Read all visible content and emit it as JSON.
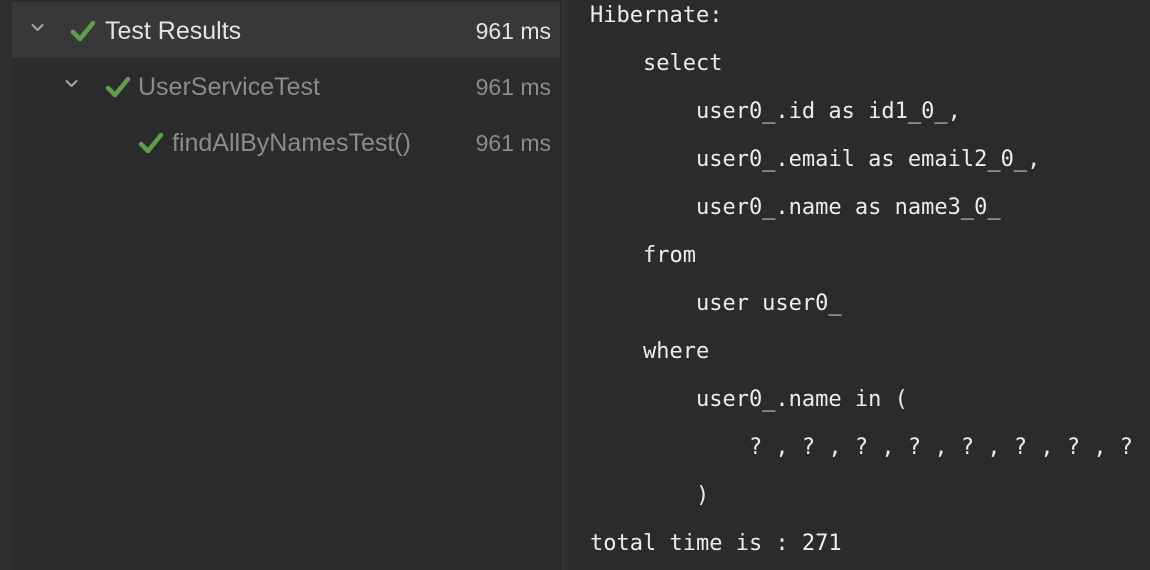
{
  "test_tree": {
    "rows": [
      {
        "label": "Test Results",
        "duration": "961 ms",
        "status": "passed",
        "expanded": true,
        "selected": true,
        "level": 0
      },
      {
        "label": "UserServiceTest",
        "duration": "961 ms",
        "status": "passed",
        "expanded": true,
        "selected": false,
        "level": 1
      },
      {
        "label": "findAllByNamesTest()",
        "duration": "961 ms",
        "status": "passed",
        "selected": false,
        "level": 2
      }
    ]
  },
  "console": {
    "lines": [
      "Hibernate:",
      "    select",
      "        user0_.id as id1_0_,",
      "        user0_.email as email2_0_,",
      "        user0_.name as name3_0_",
      "    from",
      "        user user0_",
      "    where",
      "        user0_.name in (",
      "            ? , ? , ? , ? , ? , ? , ? , ? , ? , ?",
      "        )",
      "total time is : 271"
    ]
  },
  "colors": {
    "background": "#2b2b2b",
    "selected_row": "#383838",
    "check_green": "#5e9e4a",
    "text_primary": "#e3e3e3",
    "text_secondary": "#8b8b8b",
    "console_text": "#ececec"
  },
  "icons": {
    "expand": "chevron-down-icon",
    "passed": "check-icon"
  }
}
